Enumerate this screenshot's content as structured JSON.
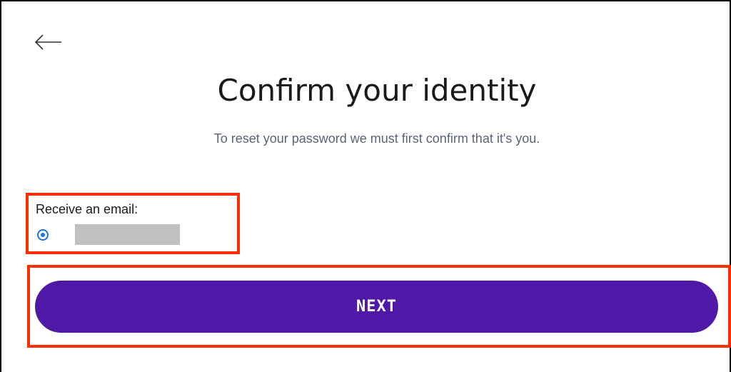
{
  "header": {
    "back_icon": "arrow-left-icon",
    "title": "Confirm your identity",
    "subtitle": "To reset your password we must first confirm that it's you."
  },
  "email_option": {
    "label": "Receive an email:",
    "selected": true,
    "email_value": ""
  },
  "actions": {
    "next_label": "NEXT"
  },
  "colors": {
    "primary_button": "#4f18a6",
    "highlight_border": "#ff2e00",
    "radio_accent": "#1a73e8",
    "subtitle_text": "#5b6477",
    "redaction": "#c0c0c0"
  }
}
